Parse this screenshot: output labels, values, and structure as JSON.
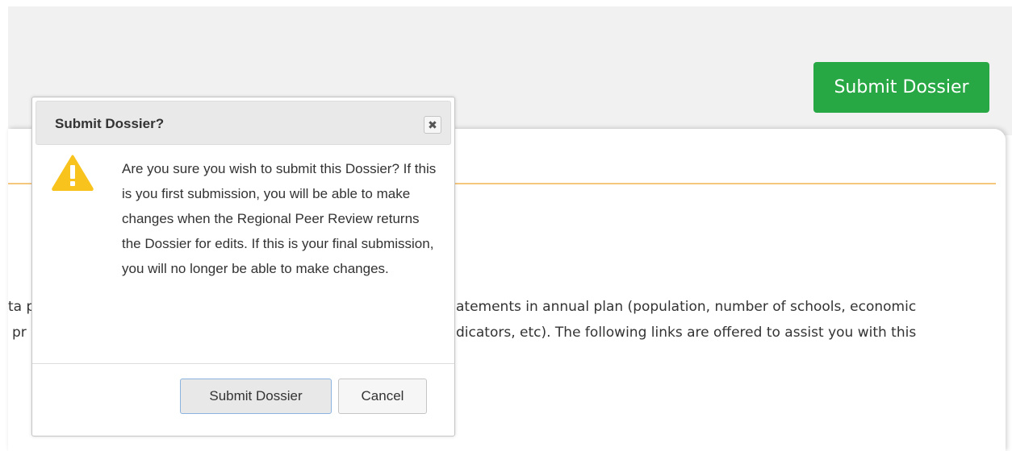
{
  "header": {
    "submit_label": "Submit Dossier"
  },
  "page": {
    "body_line_1_left": "ta p",
    "body_line_1_right": "atements in annual plan (population, number of schools, economic",
    "body_line_2_left": "pr",
    "body_line_2_right": "dicators, etc). The following links are offered to assist you with this"
  },
  "dialog": {
    "title": "Submit Dossier?",
    "close_symbol": "✖",
    "icon": "warning-icon",
    "message": "Are you sure you wish to submit this Dossier? If this is you first submission, you will be able to make changes when the Regional Peer Review returns the Dossier for edits. If this is your final submission, you will no longer be able to make changes.",
    "submit_label": "Submit Dossier",
    "cancel_label": "Cancel"
  },
  "colors": {
    "submit_green": "#28a745",
    "accent_line": "#f5c77e",
    "warning_yellow": "#f8c31c"
  }
}
